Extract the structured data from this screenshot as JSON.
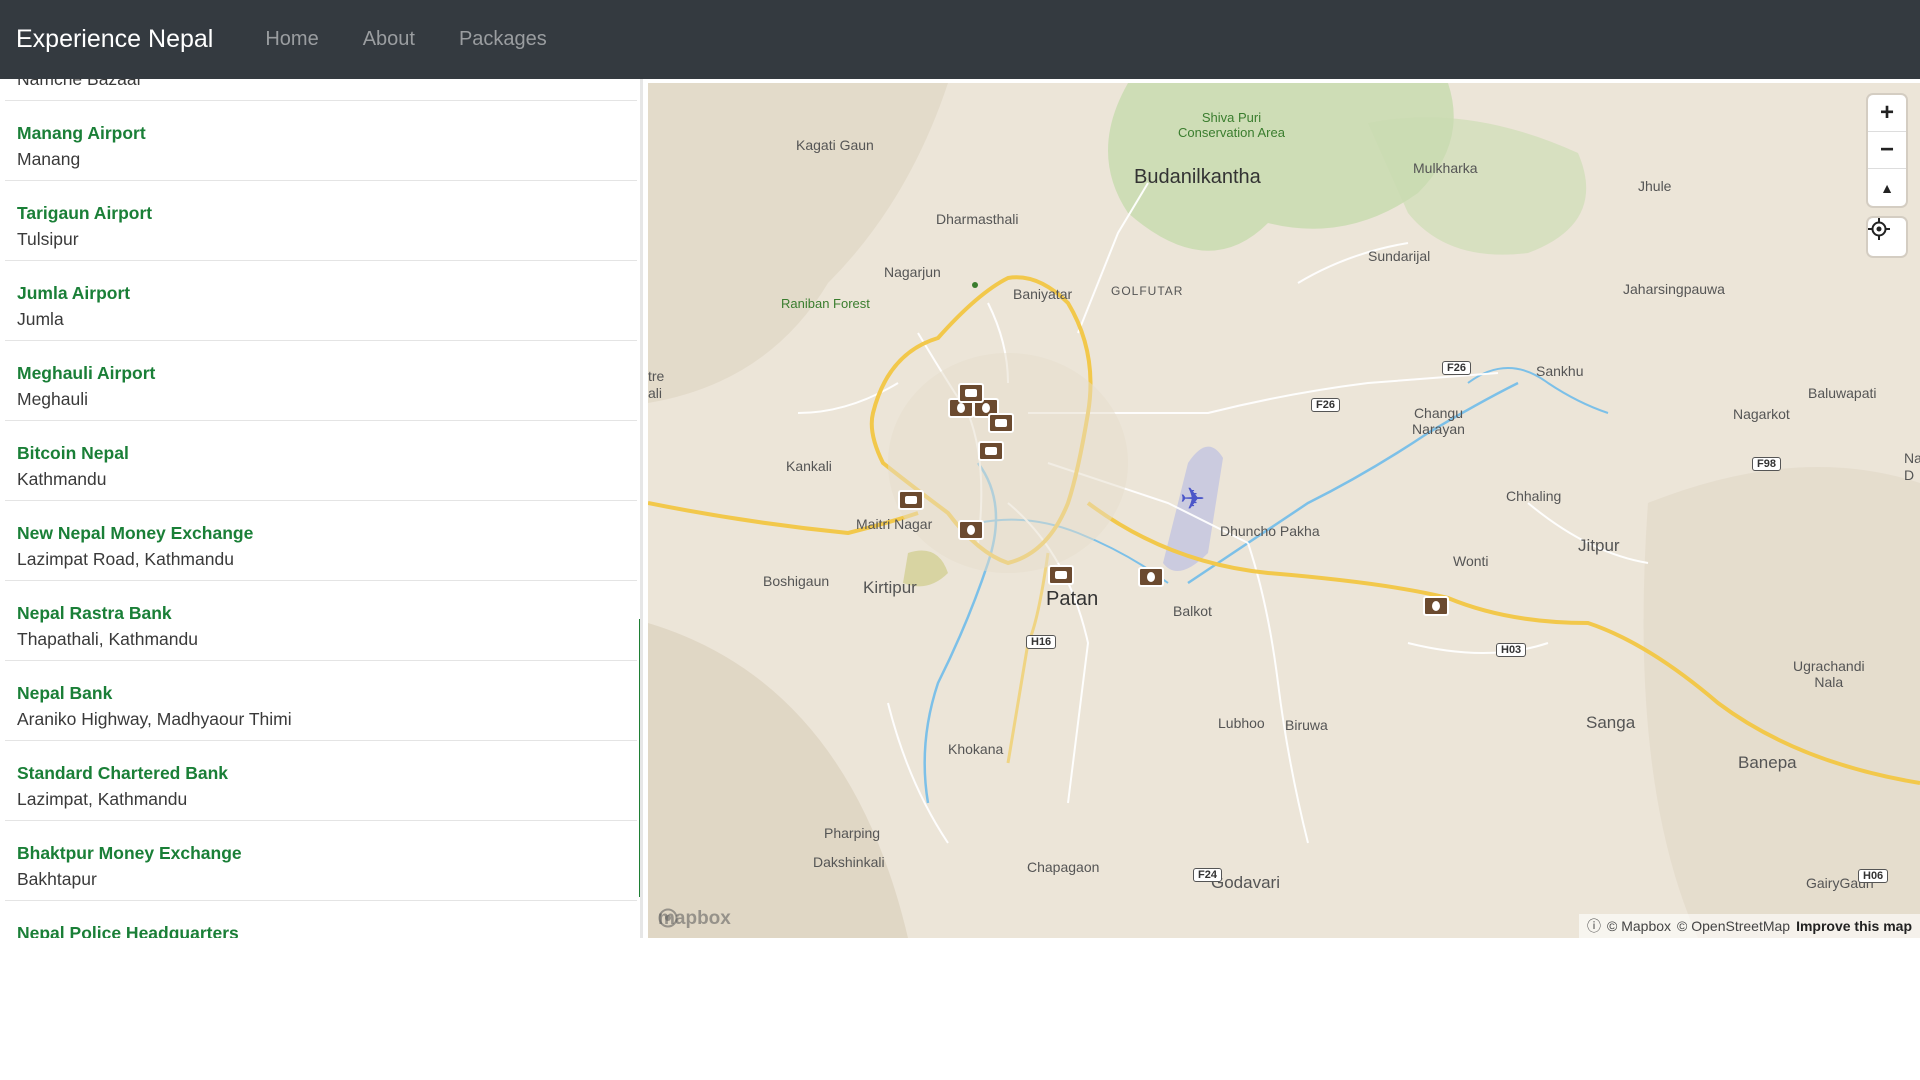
{
  "navbar": {
    "brand": "Experience Nepal",
    "links": [
      "Home",
      "About",
      "Packages"
    ]
  },
  "sidebar": {
    "items": [
      {
        "title": "",
        "subtitle": "Namche Bazaar"
      },
      {
        "title": "Manang Airport",
        "subtitle": "Manang"
      },
      {
        "title": "Tarigaun Airport",
        "subtitle": "Tulsipur"
      },
      {
        "title": "Jumla Airport",
        "subtitle": "Jumla"
      },
      {
        "title": "Meghauli Airport",
        "subtitle": "Meghauli"
      },
      {
        "title": "Bitcoin Nepal",
        "subtitle": "Kathmandu"
      },
      {
        "title": "New Nepal Money Exchange",
        "subtitle": "Lazimpat Road, Kathmandu"
      },
      {
        "title": "Nepal Rastra Bank",
        "subtitle": "Thapathali, Kathmandu"
      },
      {
        "title": "Nepal Bank",
        "subtitle": "Araniko Highway, Madhyaour Thimi"
      },
      {
        "title": "Standard Chartered Bank",
        "subtitle": "Lazimpat, Kathmandu"
      },
      {
        "title": "Bhaktpur Money Exchange",
        "subtitle": "Bakhtapur"
      },
      {
        "title": "Nepal Police Headquarters",
        "subtitle": ""
      }
    ]
  },
  "map": {
    "places": {
      "shivapuri": "Shiva Puri\nConservation Area",
      "kagati": "Kagati Gaun",
      "budanilkantha": "Budanilkantha",
      "mulkharka": "Mulkharka",
      "jhule": "Jhule",
      "dharmasthali": "Dharmasthali",
      "sundarijal": "Sundarijal",
      "nagarjun": "Nagarjun",
      "raniban": "Raniban Forest",
      "baniyatar": "Baniyatar",
      "golfutar": "GOLFUTAR",
      "jaharsing": "Jaharsingpauwa",
      "sankhu": "Sankhu",
      "baluwapati": "Baluwapati",
      "changu": "Changu\nNarayan",
      "nagarkot": "Nagarkot",
      "kankali": "Kankali",
      "chhaling": "Chhaling",
      "maitri": "Maitri Nagar",
      "dhuncho": "Dhuncho Pakha",
      "jitpur": "Jitpur",
      "boshigaun": "Boshigaun",
      "kirtipur": "Kirtipur",
      "patan": "Patan",
      "wonti": "Wonti",
      "balkot": "Balkot",
      "ugrachandi": "Ugrachandi\nNala",
      "lubhoo": "Lubhoo",
      "biruwa": "Biruwa",
      "sanga": "Sanga",
      "khokana": "Khokana",
      "banepa": "Banepa",
      "pharping": "Pharping",
      "dakshinkali": "Dakshinkali",
      "chapagaon": "Chapagaon",
      "godavari": "Godavari",
      "gairygaun": "GairyGaun",
      "tre_ali": "tre\nali",
      "na_edge": "Na\nD"
    },
    "shields": [
      "F26",
      "F26",
      "F98",
      "H16",
      "H03",
      "F24",
      "H06"
    ],
    "controls": {
      "zoom_in": "+",
      "zoom_out": "−",
      "compass": "▲"
    },
    "attribution": {
      "mapbox": "© Mapbox",
      "osm": "© OpenStreetMap",
      "improve": "Improve this map"
    },
    "logo": "mapbox"
  }
}
